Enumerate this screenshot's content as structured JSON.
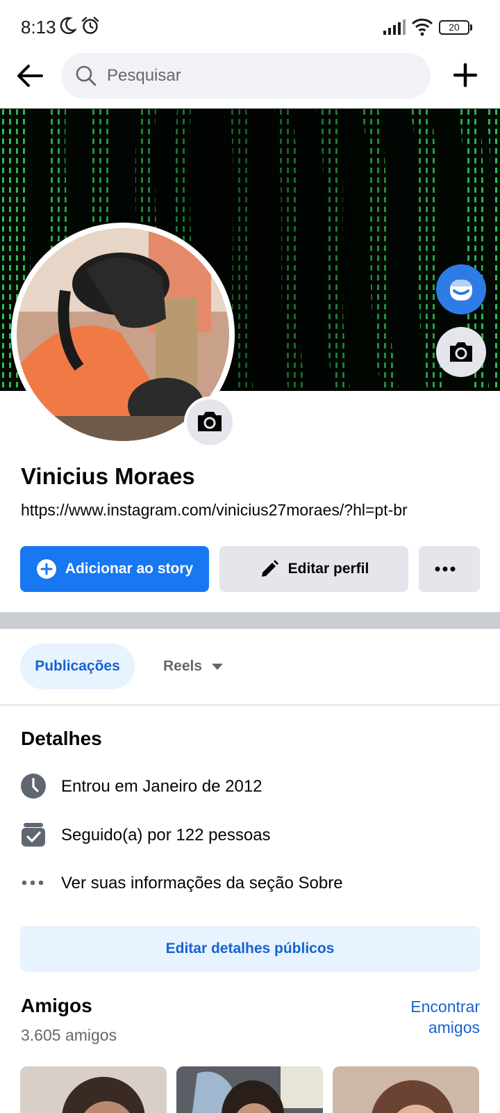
{
  "status_bar": {
    "time": "8:13",
    "battery": "20",
    "icons": [
      "moon-icon",
      "alarm-icon",
      "signal-icon",
      "wifi-icon",
      "battery-icon"
    ]
  },
  "header": {
    "search_placeholder": "Pesquisar",
    "icons": [
      "back-arrow-icon",
      "search-icon",
      "plus-icon"
    ]
  },
  "profile": {
    "name": "Vinicius Moraes",
    "bio": "https://www.instagram.com/vinicius27moraes/?hl=pt-br"
  },
  "actions": {
    "add_story": "Adicionar ao story",
    "edit_profile": "Editar perfil"
  },
  "tabs": [
    {
      "label": "Publicações",
      "selected": true
    },
    {
      "label": "Reels",
      "selected": false
    }
  ],
  "details": {
    "title": "Detalhes",
    "items": [
      {
        "icon": "clock-icon",
        "text": "Entrou em Janeiro de 2012"
      },
      {
        "icon": "followers-icon",
        "text": "Seguido(a) por 122 pessoas"
      },
      {
        "icon": "more-dots-icon",
        "text": "Ver suas informações da seção Sobre"
      }
    ],
    "edit_button": "Editar detalhes públicos"
  },
  "friends": {
    "title": "Amigos",
    "count": "3.605 amigos",
    "find_link": "Encontrar amigos"
  },
  "colors": {
    "accent": "#1877f2",
    "link": "#1763cf",
    "light_accent_bg": "#e7f3ff",
    "secondary_bg": "#e4e6eb",
    "cover_green": "#27c94a"
  }
}
